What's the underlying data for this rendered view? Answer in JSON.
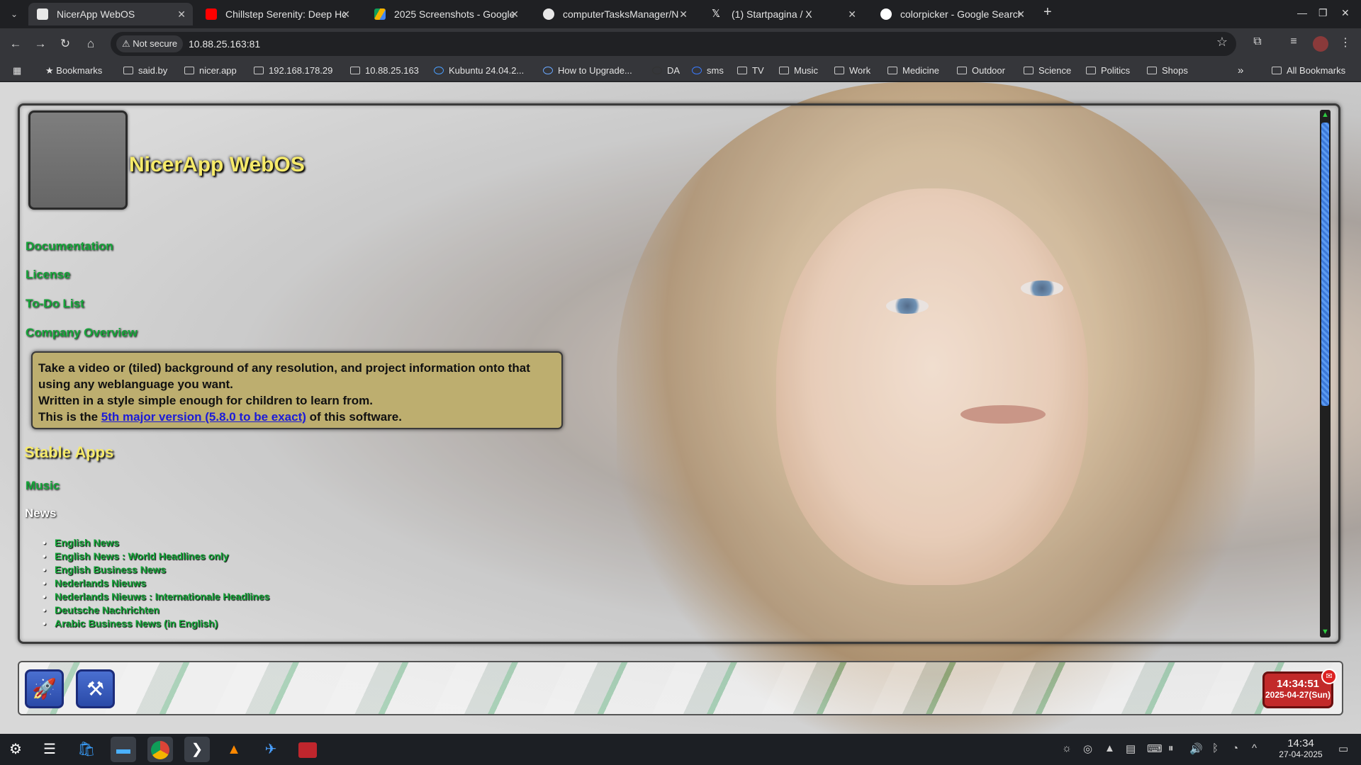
{
  "browser": {
    "tabs": [
      {
        "title": "NicerApp WebOS",
        "active": true,
        "favicon": "nicerapp-icon",
        "color": "#ffffff"
      },
      {
        "title": "Chillstep Serenity: Deep Ho",
        "active": false,
        "favicon": "youtube-icon",
        "color": "#ff0000"
      },
      {
        "title": "2025 Screenshots - Google",
        "active": false,
        "favicon": "google-drive-icon",
        "color": "#f4b400"
      },
      {
        "title": "computerTasksManager/N",
        "active": false,
        "favicon": "github-icon",
        "color": "#ffffff"
      },
      {
        "title": "(1) Startpagina / X",
        "active": false,
        "favicon": "x-icon",
        "color": "#ffffff"
      },
      {
        "title": "colorpicker - Google Search",
        "active": false,
        "favicon": "google-icon",
        "color": "#4285f4"
      }
    ],
    "tab_close_glyph": "✕",
    "new_tab_glyph": "+",
    "address": {
      "security_label": "Not secure",
      "url": "10.88.25.163:81"
    },
    "bookmarks": [
      {
        "label": "Bookmarks",
        "icon": "star-icon"
      },
      {
        "label": "said.by",
        "icon": "folder-icon"
      },
      {
        "label": "nicer.app",
        "icon": "folder-icon"
      },
      {
        "label": "192.168.178.29",
        "icon": "folder-icon"
      },
      {
        "label": "10.88.25.163",
        "icon": "folder-icon"
      },
      {
        "label": "Kubuntu 24.04.2...",
        "icon": "kubuntu-icon"
      },
      {
        "label": "How to Upgrade...",
        "icon": "info-icon"
      },
      {
        "label": "DA",
        "icon": "da-icon"
      },
      {
        "label": "sms",
        "icon": "chat-icon"
      },
      {
        "label": "TV",
        "icon": "folder-icon"
      },
      {
        "label": "Music",
        "icon": "folder-icon"
      },
      {
        "label": "Work",
        "icon": "folder-icon"
      },
      {
        "label": "Medicine",
        "icon": "folder-icon"
      },
      {
        "label": "Outdoor",
        "icon": "folder-icon"
      },
      {
        "label": "Science",
        "icon": "folder-icon"
      },
      {
        "label": "Politics",
        "icon": "folder-icon"
      },
      {
        "label": "Shops",
        "icon": "folder-icon"
      }
    ],
    "all_bookmarks_label": "All Bookmarks",
    "overflow_glyph": "»"
  },
  "site": {
    "title": "NicerApp WebOS",
    "menu": [
      {
        "label": "Documentation"
      },
      {
        "label": "License"
      },
      {
        "label": "To-Do List"
      },
      {
        "label": "Company Overview"
      }
    ],
    "info": {
      "line1": "Take a video or (tiled) background of any resolution, and project information onto that using any weblanguage you want.",
      "line2": "Written in a style simple enough for children to learn from.",
      "line3_pre": "This is the ",
      "line3_link": "5th major version (5.8.0 to be exact)",
      "line3_post": " of this software."
    },
    "stable_apps_title": "Stable Apps",
    "music_label": "Music",
    "news_title": "News",
    "news_items": [
      "English News",
      "English News : World Headlines only",
      "English Business News",
      "Nederlands Nieuws",
      "Nederlands Nieuws : Internationale Headlines",
      "Deutsche Nachrichten",
      "Arabic Business News (in English)"
    ],
    "dock_clock": {
      "time": "14:34:51",
      "date": "2025-04-27(Sun)"
    },
    "colors": {
      "title": "#f6ea6a",
      "link": "#16a63a",
      "info_bg": "#bdae6f",
      "clock_bg": "#c22a2a"
    }
  },
  "taskbar": {
    "apps": [
      "app-launcher-icon",
      "settings-icon",
      "store-icon",
      "file-manager-icon",
      "chrome-icon",
      "terminal-icon",
      "vlc-icon",
      "thunderbird-icon",
      "filezilla-icon"
    ],
    "clock": {
      "time": "14:34",
      "date": "27-04-2025"
    }
  }
}
